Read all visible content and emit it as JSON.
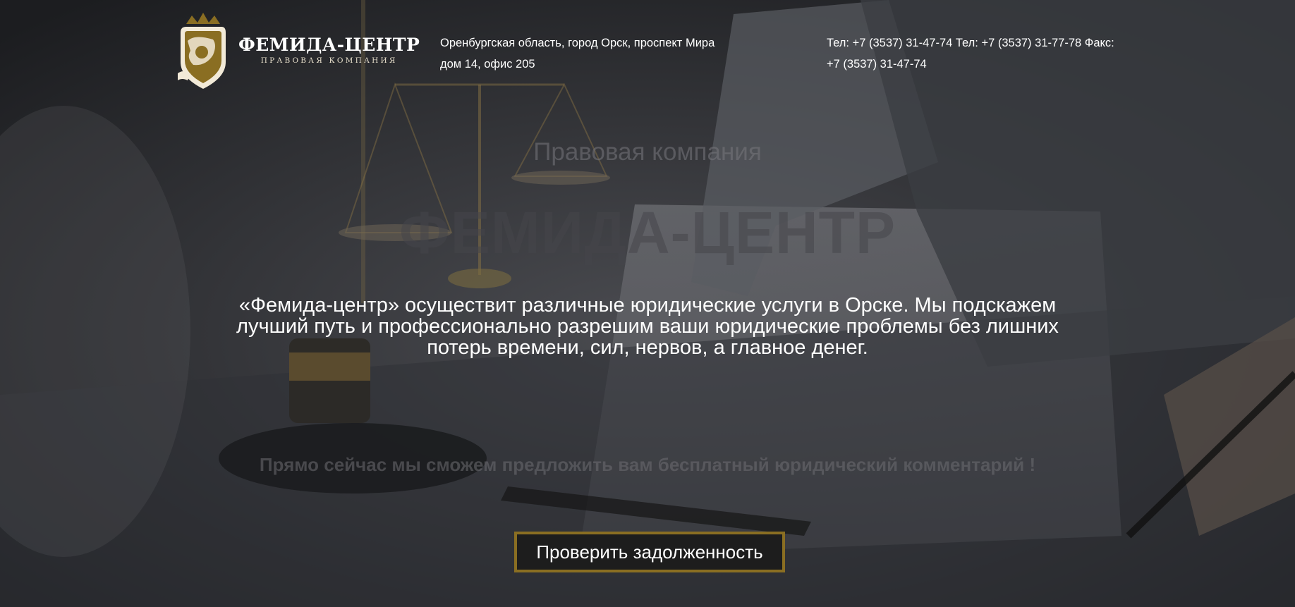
{
  "header": {
    "logo": {
      "name": "ФЕМИДА-ЦЕНТР",
      "tagline": "ПРАВОВАЯ КОМПАНИЯ"
    },
    "address_lines": [
      "Оренбургская область, город Орск, проспект Мира",
      "дом 14, офис 205"
    ],
    "contact_lines": [
      "Тел: +7 (3537) 31-47-74 Тел: +7 (3537) 31-77-78 Факс:",
      "+7 (3537) 31-47-74"
    ]
  },
  "hero": {
    "subtitle": "Правовая компания",
    "title": "ФЕМИДА-ЦЕНТР",
    "description_lines": [
      "«Фемида-центр» осуществит различные юридические услуги в Орске. Мы подскажем",
      "лучший путь и профессионально разрешим ваши юридические проблемы без лишних",
      "потерь времени, сил, нервов, а главное денег."
    ],
    "offer": "Прямо сейчас мы сможем предложить вам бесплатный юридический комментарий !",
    "cta_label": "Проверить задолженность"
  },
  "colors": {
    "accent": "#8a6e22",
    "overlay": "#2a2c30",
    "text": "#ffffff"
  },
  "icons": {
    "logo": "scroll-shield-crown-emblem"
  }
}
